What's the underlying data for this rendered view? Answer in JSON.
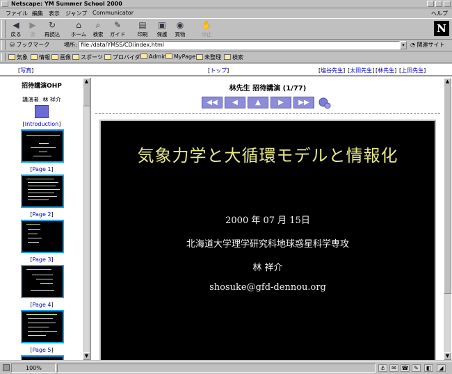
{
  "window": {
    "title": "Netscape: YM Summer School 2000"
  },
  "menu": {
    "items": [
      "ファイル",
      "編集",
      "表示",
      "ジャンプ",
      "Communicator"
    ],
    "help": "ヘルプ"
  },
  "toolbar": {
    "back": "戻る",
    "forward": "次",
    "reload": "再読込",
    "home": "ホーム",
    "search": "検索",
    "guide": "ガイド",
    "print": "印刷",
    "security": "保護",
    "shop": "買物",
    "stop": "中止"
  },
  "location": {
    "bookmarks": "ブックマーク",
    "label": "場所:",
    "url": "file:/data/YMSS/CD/index.html",
    "related": "関連サイト"
  },
  "personal": {
    "items": [
      "気象",
      "情報",
      "画像",
      "スポーツ",
      "プロバイダ",
      "Admin",
      "MyPage",
      "未整理",
      "検索"
    ]
  },
  "topnav": {
    "photo": "写真",
    "top": "トップ",
    "speakers": [
      "塩谷先生",
      "太田先生",
      "林先生",
      "上田先生"
    ]
  },
  "sidebar": {
    "heading": "招待講演OHP",
    "speaker": "講演者: 林 祥介",
    "intro": "Introduction",
    "pages": [
      "Page 1",
      "Page 2",
      "Page 3",
      "Page 4",
      "Page 5"
    ]
  },
  "main": {
    "heading": "林先生 招待講演 (1/77)",
    "nav": [
      "◀◀",
      "◀",
      "▲",
      "▶",
      "▶▶"
    ]
  },
  "slide": {
    "title": "気象力学と大循環モデルと情報化",
    "date": "2000 年 07 月 15日",
    "affiliation": "北海道大学理学研究科地球惑星科学専攻",
    "author": "林 祥介",
    "email": "shosuke@gfd-dennou.org"
  },
  "status": {
    "zoom": "100%"
  }
}
